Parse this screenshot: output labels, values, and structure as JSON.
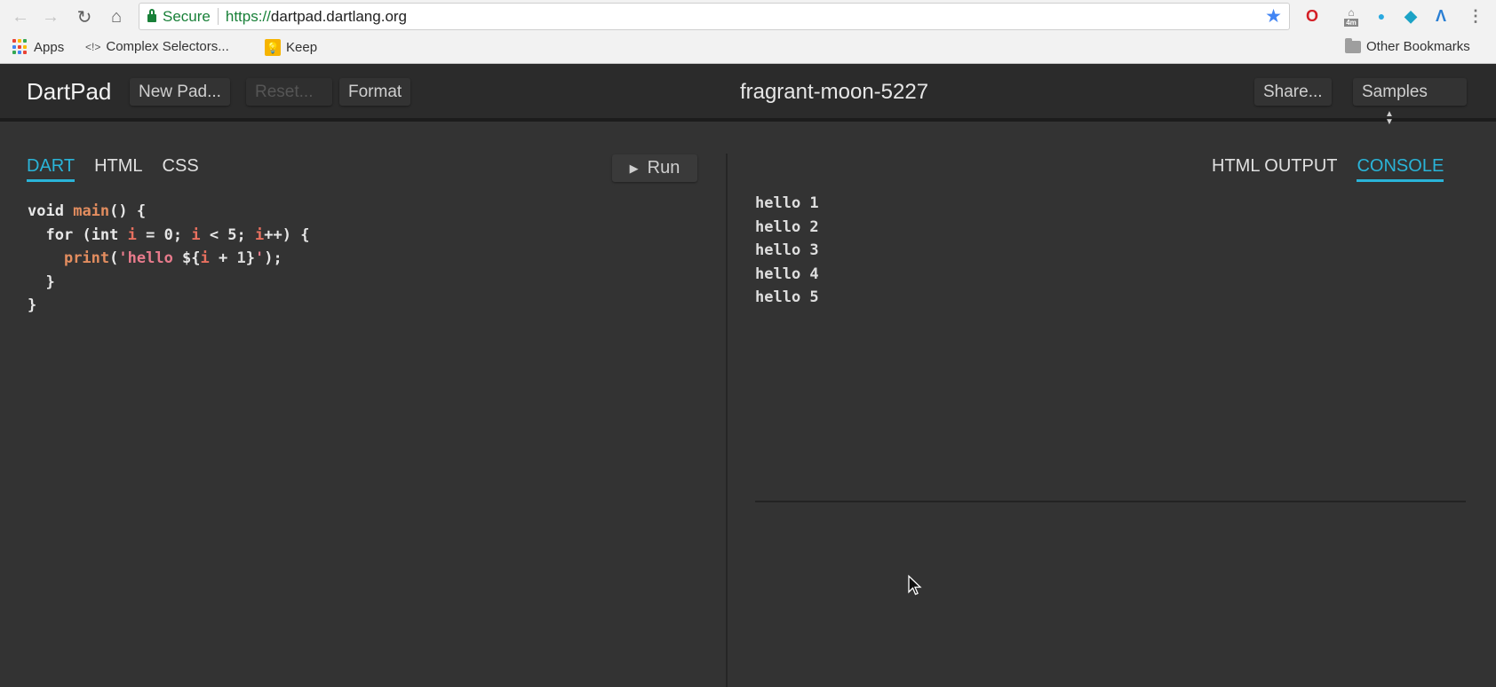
{
  "browser": {
    "nav": {
      "back_icon": "arrow-left-icon",
      "forward_icon": "arrow-right-icon",
      "reload_icon": "reload-icon",
      "home_icon": "home-icon"
    },
    "omnibox": {
      "security_label": "Secure",
      "url_scheme": "https://",
      "url_host": "dartpad.dartlang.org"
    },
    "extensions": [
      "opera-icon",
      "timer-extension-icon",
      "drop-icon",
      "diamond-icon",
      "lambda-icon",
      "menu-kebab-icon"
    ],
    "extension_badge": "4m",
    "bookmarks": [
      {
        "label": "Apps",
        "icon": "apps-grid-icon"
      },
      {
        "label": "Complex Selectors...",
        "icon": "code-brackets-icon"
      },
      {
        "label": "Keep",
        "icon": "keep-icon"
      }
    ],
    "other_bookmarks": "Other Bookmarks"
  },
  "header": {
    "brand": "DartPad",
    "buttons": {
      "new_pad": "New Pad...",
      "reset": "Reset...",
      "format": "Format",
      "share": "Share...",
      "samples": "Samples"
    },
    "pad_name": "fragrant-moon-5227"
  },
  "editor": {
    "tabs": [
      {
        "label": "DART",
        "active": true
      },
      {
        "label": "HTML",
        "active": false
      },
      {
        "label": "CSS",
        "active": false
      }
    ],
    "run_label": "Run",
    "code_lines": [
      "void main() {",
      "  for (int i = 0; i < 5; i++) {",
      "    print('hello ${i + 1}');",
      "  }",
      "}"
    ]
  },
  "output": {
    "tabs": [
      {
        "label": "HTML OUTPUT",
        "active": false
      },
      {
        "label": "CONSOLE",
        "active": true
      }
    ],
    "console_lines": [
      "hello 1",
      "hello 2",
      "hello 3",
      "hello 4",
      "hello 5"
    ]
  },
  "colors": {
    "accent": "#2ab4d8",
    "background": "#333333",
    "header_bg": "#2b2b2b"
  }
}
